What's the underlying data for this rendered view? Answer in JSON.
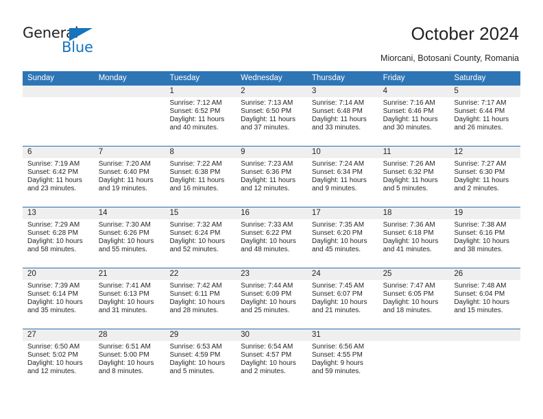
{
  "brand": {
    "name_top": "General",
    "name_bottom": "Blue",
    "accent_color": "#1574bb"
  },
  "header": {
    "title": "October 2024",
    "subtitle": "Miorcani, Botosani County, Romania"
  },
  "theme": {
    "header_row_color": "#2e75b6",
    "week_divider_color": "#1f6cb0",
    "daynum_bar_color": "#efefef"
  },
  "weekdays": [
    "Sunday",
    "Monday",
    "Tuesday",
    "Wednesday",
    "Thursday",
    "Friday",
    "Saturday"
  ],
  "weeks": [
    [
      {
        "day": "",
        "empty": true
      },
      {
        "day": "",
        "empty": true
      },
      {
        "day": "1",
        "sunrise": "Sunrise: 7:12 AM",
        "sunset": "Sunset: 6:52 PM",
        "daylight1": "Daylight: 11 hours",
        "daylight2": "and 40 minutes."
      },
      {
        "day": "2",
        "sunrise": "Sunrise: 7:13 AM",
        "sunset": "Sunset: 6:50 PM",
        "daylight1": "Daylight: 11 hours",
        "daylight2": "and 37 minutes."
      },
      {
        "day": "3",
        "sunrise": "Sunrise: 7:14 AM",
        "sunset": "Sunset: 6:48 PM",
        "daylight1": "Daylight: 11 hours",
        "daylight2": "and 33 minutes."
      },
      {
        "day": "4",
        "sunrise": "Sunrise: 7:16 AM",
        "sunset": "Sunset: 6:46 PM",
        "daylight1": "Daylight: 11 hours",
        "daylight2": "and 30 minutes."
      },
      {
        "day": "5",
        "sunrise": "Sunrise: 7:17 AM",
        "sunset": "Sunset: 6:44 PM",
        "daylight1": "Daylight: 11 hours",
        "daylight2": "and 26 minutes."
      }
    ],
    [
      {
        "day": "6",
        "sunrise": "Sunrise: 7:19 AM",
        "sunset": "Sunset: 6:42 PM",
        "daylight1": "Daylight: 11 hours",
        "daylight2": "and 23 minutes."
      },
      {
        "day": "7",
        "sunrise": "Sunrise: 7:20 AM",
        "sunset": "Sunset: 6:40 PM",
        "daylight1": "Daylight: 11 hours",
        "daylight2": "and 19 minutes."
      },
      {
        "day": "8",
        "sunrise": "Sunrise: 7:22 AM",
        "sunset": "Sunset: 6:38 PM",
        "daylight1": "Daylight: 11 hours",
        "daylight2": "and 16 minutes."
      },
      {
        "day": "9",
        "sunrise": "Sunrise: 7:23 AM",
        "sunset": "Sunset: 6:36 PM",
        "daylight1": "Daylight: 11 hours",
        "daylight2": "and 12 minutes."
      },
      {
        "day": "10",
        "sunrise": "Sunrise: 7:24 AM",
        "sunset": "Sunset: 6:34 PM",
        "daylight1": "Daylight: 11 hours",
        "daylight2": "and 9 minutes."
      },
      {
        "day": "11",
        "sunrise": "Sunrise: 7:26 AM",
        "sunset": "Sunset: 6:32 PM",
        "daylight1": "Daylight: 11 hours",
        "daylight2": "and 5 minutes."
      },
      {
        "day": "12",
        "sunrise": "Sunrise: 7:27 AM",
        "sunset": "Sunset: 6:30 PM",
        "daylight1": "Daylight: 11 hours",
        "daylight2": "and 2 minutes."
      }
    ],
    [
      {
        "day": "13",
        "sunrise": "Sunrise: 7:29 AM",
        "sunset": "Sunset: 6:28 PM",
        "daylight1": "Daylight: 10 hours",
        "daylight2": "and 58 minutes."
      },
      {
        "day": "14",
        "sunrise": "Sunrise: 7:30 AM",
        "sunset": "Sunset: 6:26 PM",
        "daylight1": "Daylight: 10 hours",
        "daylight2": "and 55 minutes."
      },
      {
        "day": "15",
        "sunrise": "Sunrise: 7:32 AM",
        "sunset": "Sunset: 6:24 PM",
        "daylight1": "Daylight: 10 hours",
        "daylight2": "and 52 minutes."
      },
      {
        "day": "16",
        "sunrise": "Sunrise: 7:33 AM",
        "sunset": "Sunset: 6:22 PM",
        "daylight1": "Daylight: 10 hours",
        "daylight2": "and 48 minutes."
      },
      {
        "day": "17",
        "sunrise": "Sunrise: 7:35 AM",
        "sunset": "Sunset: 6:20 PM",
        "daylight1": "Daylight: 10 hours",
        "daylight2": "and 45 minutes."
      },
      {
        "day": "18",
        "sunrise": "Sunrise: 7:36 AM",
        "sunset": "Sunset: 6:18 PM",
        "daylight1": "Daylight: 10 hours",
        "daylight2": "and 41 minutes."
      },
      {
        "day": "19",
        "sunrise": "Sunrise: 7:38 AM",
        "sunset": "Sunset: 6:16 PM",
        "daylight1": "Daylight: 10 hours",
        "daylight2": "and 38 minutes."
      }
    ],
    [
      {
        "day": "20",
        "sunrise": "Sunrise: 7:39 AM",
        "sunset": "Sunset: 6:14 PM",
        "daylight1": "Daylight: 10 hours",
        "daylight2": "and 35 minutes."
      },
      {
        "day": "21",
        "sunrise": "Sunrise: 7:41 AM",
        "sunset": "Sunset: 6:13 PM",
        "daylight1": "Daylight: 10 hours",
        "daylight2": "and 31 minutes."
      },
      {
        "day": "22",
        "sunrise": "Sunrise: 7:42 AM",
        "sunset": "Sunset: 6:11 PM",
        "daylight1": "Daylight: 10 hours",
        "daylight2": "and 28 minutes."
      },
      {
        "day": "23",
        "sunrise": "Sunrise: 7:44 AM",
        "sunset": "Sunset: 6:09 PM",
        "daylight1": "Daylight: 10 hours",
        "daylight2": "and 25 minutes."
      },
      {
        "day": "24",
        "sunrise": "Sunrise: 7:45 AM",
        "sunset": "Sunset: 6:07 PM",
        "daylight1": "Daylight: 10 hours",
        "daylight2": "and 21 minutes."
      },
      {
        "day": "25",
        "sunrise": "Sunrise: 7:47 AM",
        "sunset": "Sunset: 6:05 PM",
        "daylight1": "Daylight: 10 hours",
        "daylight2": "and 18 minutes."
      },
      {
        "day": "26",
        "sunrise": "Sunrise: 7:48 AM",
        "sunset": "Sunset: 6:04 PM",
        "daylight1": "Daylight: 10 hours",
        "daylight2": "and 15 minutes."
      }
    ],
    [
      {
        "day": "27",
        "sunrise": "Sunrise: 6:50 AM",
        "sunset": "Sunset: 5:02 PM",
        "daylight1": "Daylight: 10 hours",
        "daylight2": "and 12 minutes."
      },
      {
        "day": "28",
        "sunrise": "Sunrise: 6:51 AM",
        "sunset": "Sunset: 5:00 PM",
        "daylight1": "Daylight: 10 hours",
        "daylight2": "and 8 minutes."
      },
      {
        "day": "29",
        "sunrise": "Sunrise: 6:53 AM",
        "sunset": "Sunset: 4:59 PM",
        "daylight1": "Daylight: 10 hours",
        "daylight2": "and 5 minutes."
      },
      {
        "day": "30",
        "sunrise": "Sunrise: 6:54 AM",
        "sunset": "Sunset: 4:57 PM",
        "daylight1": "Daylight: 10 hours",
        "daylight2": "and 2 minutes."
      },
      {
        "day": "31",
        "sunrise": "Sunrise: 6:56 AM",
        "sunset": "Sunset: 4:55 PM",
        "daylight1": "Daylight: 9 hours",
        "daylight2": "and 59 minutes."
      },
      {
        "day": "",
        "empty": true
      },
      {
        "day": "",
        "empty": true
      }
    ]
  ]
}
